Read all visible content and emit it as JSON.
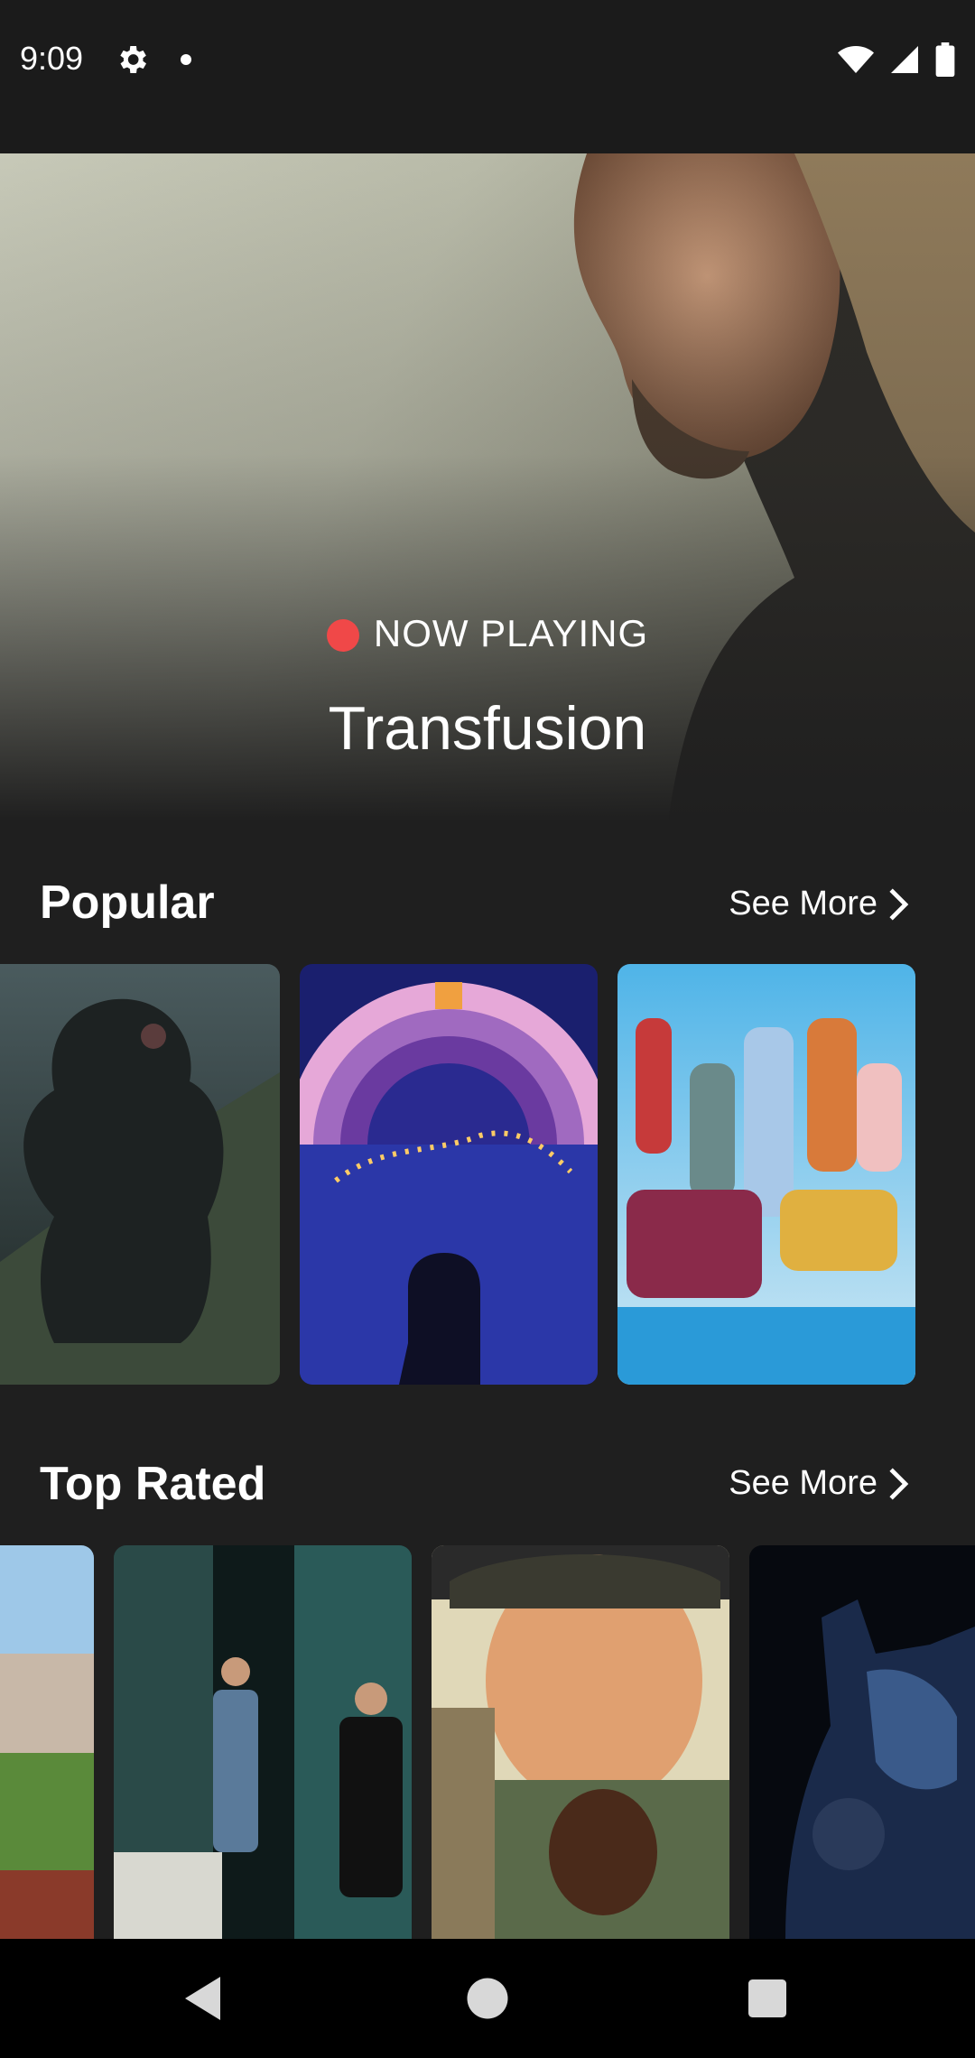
{
  "status_bar": {
    "time": "9:09",
    "icons": [
      "gear-icon",
      "notification-dot-icon",
      "wifi-icon",
      "signal-icon",
      "battery-icon"
    ]
  },
  "hero": {
    "badge": "NOW PLAYING",
    "title": "Transfusion",
    "badge_color": "#f04848"
  },
  "sections": {
    "popular": {
      "title": "Popular",
      "see_more": "See More"
    },
    "top_rated": {
      "title": "Top Rated",
      "see_more": "See More"
    }
  },
  "navigation": {
    "back": "back-icon",
    "home": "home-icon",
    "recents": "recents-icon"
  },
  "colors": {
    "background": "#1f1f1f",
    "status_bar": "#1b1b1b",
    "nav_bar": "#000000",
    "accent": "#f04848"
  }
}
